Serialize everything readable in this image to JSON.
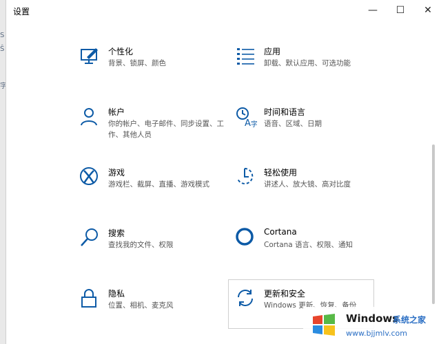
{
  "window": {
    "title": "设置",
    "controls": {
      "minimize": "—",
      "maximize": "☐",
      "close": "✕"
    }
  },
  "background": {
    "marks": [
      "S",
      "Ŝ",
      "字"
    ]
  },
  "colors": {
    "accent": "#0c5aa6",
    "text": "#000000",
    "subtext": "#555555"
  },
  "tiles": [
    {
      "name": "个性化",
      "desc": "背景、锁屏、颜色",
      "icon": "personalization-icon"
    },
    {
      "name": "应用",
      "desc": "卸载、默认应用、可选功能",
      "icon": "apps-icon"
    },
    {
      "name": "帐户",
      "desc": "你的帐户、电子邮件、同步设置、工作、其他人员",
      "icon": "account-icon"
    },
    {
      "name": "时间和语言",
      "desc": "语音、区域、日期",
      "icon": "time-language-icon"
    },
    {
      "name": "游戏",
      "desc": "游戏栏、截屏、直播、游戏模式",
      "icon": "xbox-icon"
    },
    {
      "name": "轻松使用",
      "desc": "讲述人、放大镜、高对比度",
      "icon": "ease-of-access-icon"
    },
    {
      "name": "搜索",
      "desc": "查找我的文件、权限",
      "icon": "search-icon"
    },
    {
      "name": "Cortana",
      "desc": "Cortana 语言、权限、通知",
      "icon": "cortana-icon"
    },
    {
      "name": "隐私",
      "desc": "位置、相机、麦克风",
      "icon": "lock-icon"
    },
    {
      "name": "更新和安全",
      "desc": "Windows 更新、恢复、备份",
      "icon": "update-icon"
    }
  ],
  "watermark": {
    "brand": "Windows",
    "sub": "系统之家",
    "url": "www.bjjmlv.com"
  }
}
